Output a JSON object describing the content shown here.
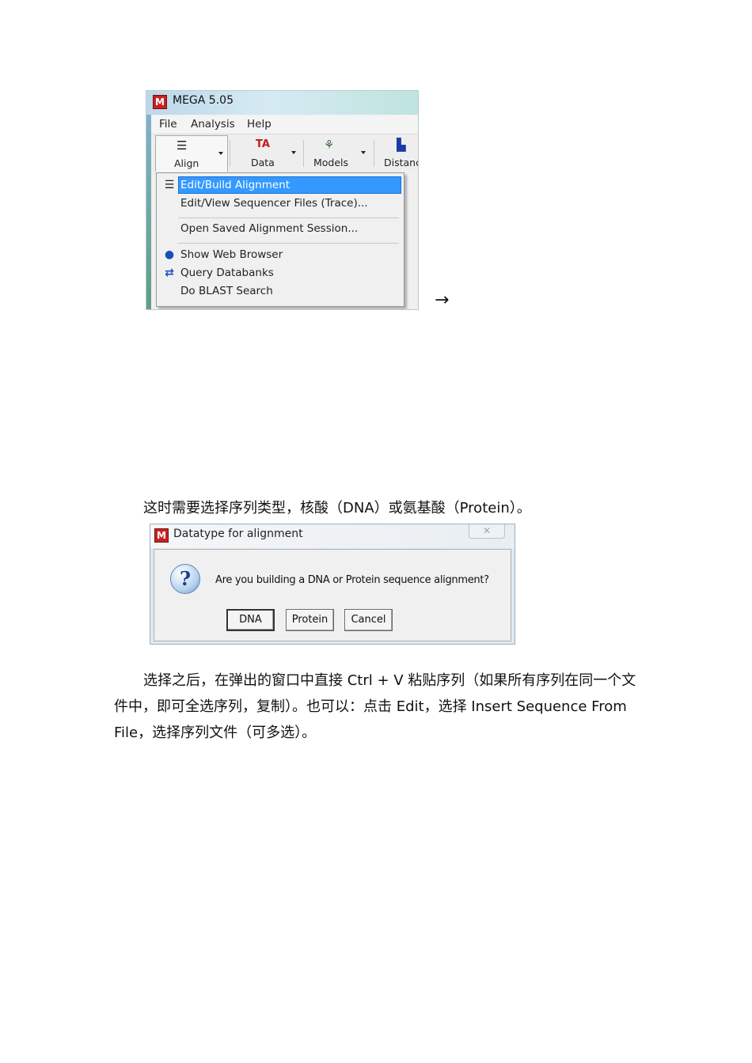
{
  "mega_window": {
    "logo": "M",
    "title": "MEGA 5.05",
    "menubar": [
      "File",
      "Analysis",
      "Help"
    ],
    "toolbar": {
      "align": "Align",
      "data": "Data",
      "models": "Models",
      "distance": "Distanc"
    },
    "align_menu": {
      "items": [
        "Edit/Build Alignment",
        "Edit/View Sequencer Files (Trace)...",
        "Open Saved Alignment Session...",
        "Show Web Browser",
        "Query Databanks",
        "Do BLAST Search"
      ],
      "highlighted_index": 0
    }
  },
  "arrow": "→",
  "paragraph_1": "这时需要选择序列类型，核酸（DNA）或氨基酸（Protein）。",
  "dialog": {
    "logo": "M",
    "title": "Datatype for alignment",
    "close_glyph": "✕",
    "message": "Are you building a DNA or Protein sequence alignment?",
    "buttons": {
      "dna": "DNA",
      "protein": "Protein",
      "cancel": "Cancel"
    }
  },
  "paragraph_2": "选择之后，在弹出的窗口中直接 Ctrl + V 粘贴序列（如果所有序列在同一个文件中，即可全选序列，复制）。也可以：点击 Edit，选择 Insert Sequence From File，选择序列文件（可多选）。",
  "colors": {
    "highlight": "#3399ff",
    "logo_red": "#c62222"
  }
}
